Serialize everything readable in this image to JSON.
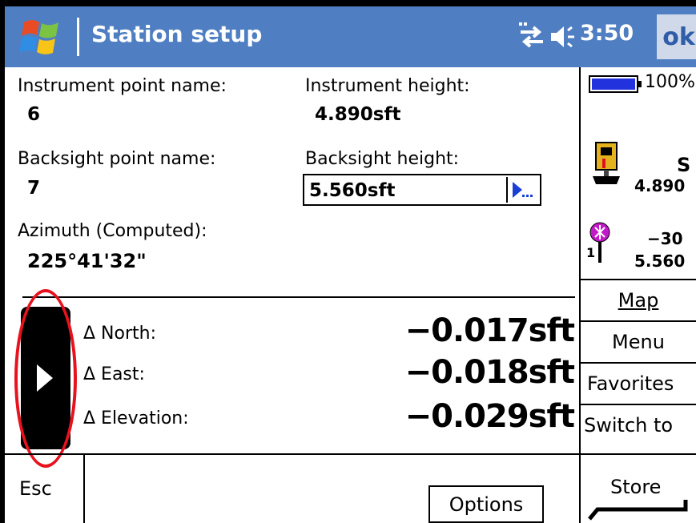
{
  "titlebar": {
    "title": "Station setup",
    "clock": "3:50",
    "ok_label": "ok",
    "icons": [
      "windows-start-icon",
      "connectivity-icon",
      "speaker-icon"
    ]
  },
  "instrument": {
    "point_label": "Instrument point name:",
    "point_value": "6",
    "height_label": "Instrument height:",
    "height_value": "4.890sft"
  },
  "backsight": {
    "point_label": "Backsight point name:",
    "point_value": "7",
    "height_label": "Backsight height:",
    "height_value": "5.560sft"
  },
  "azimuth": {
    "label": "Azimuth (Computed):",
    "value": "225°41'32\""
  },
  "deltas": [
    {
      "label": "Δ North:",
      "value": "−0.017sft"
    },
    {
      "label": "Δ East:",
      "value": "−0.018sft"
    },
    {
      "label": "Δ Elevation:",
      "value": "−0.029sft"
    }
  ],
  "status": {
    "battery_pct": "100%",
    "instrument_letter": "S",
    "instrument_height": "4.890",
    "target_number": "1",
    "target_value": "−30",
    "target_height": "5.560"
  },
  "sidebar": {
    "map": "Map",
    "menu": "Menu",
    "favorites": "Favorites",
    "switch_to": "Switch to"
  },
  "bottom": {
    "esc": "Esc",
    "options": "Options",
    "store": "Store"
  },
  "colors": {
    "titlebar": "#4f7fc2",
    "highlight": "#e8121e"
  }
}
